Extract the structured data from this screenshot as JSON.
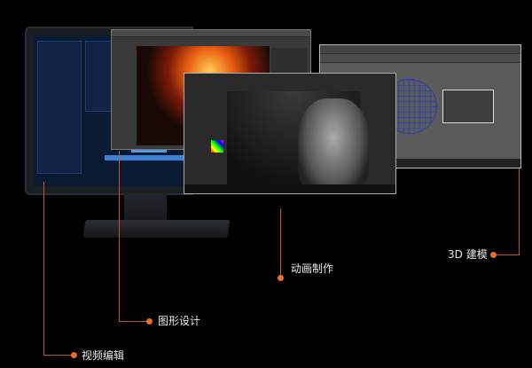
{
  "labels": {
    "video_editing": "视频编辑",
    "graphic_design": "图形设计",
    "animation": "动画制作",
    "modeling_3d": "3D 建模"
  },
  "colors": {
    "accent": "#f06a28",
    "background": "#000000"
  }
}
